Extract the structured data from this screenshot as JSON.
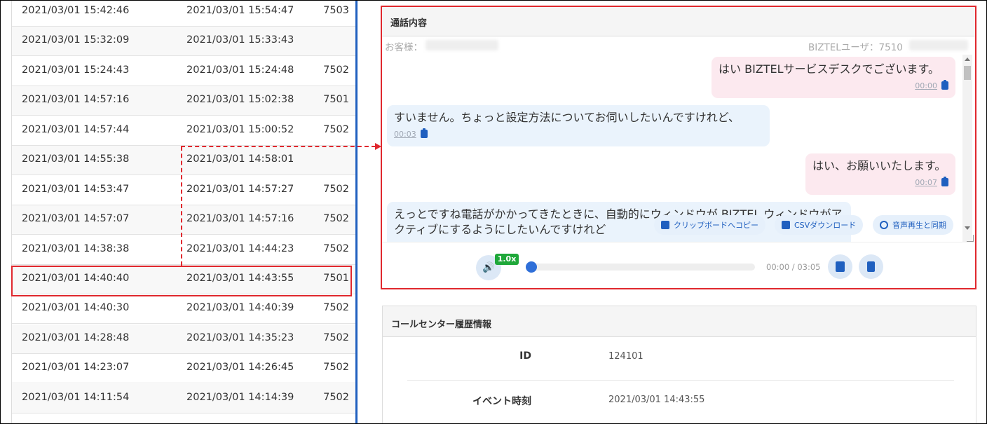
{
  "left_table": {
    "rows": [
      {
        "start": "2021/03/01 15:42:46",
        "end": "2021/03/01 15:54:47",
        "ext": "7503"
      },
      {
        "start": "2021/03/01 15:32:09",
        "end": "2021/03/01 15:33:43",
        "ext": ""
      },
      {
        "start": "2021/03/01 15:24:43",
        "end": "2021/03/01 15:24:48",
        "ext": "7502"
      },
      {
        "start": "2021/03/01 14:57:16",
        "end": "2021/03/01 15:02:38",
        "ext": "7501"
      },
      {
        "start": "2021/03/01 14:57:44",
        "end": "2021/03/01 15:00:52",
        "ext": "7502"
      },
      {
        "start": "2021/03/01 14:55:38",
        "end": "2021/03/01 14:58:01",
        "ext": ""
      },
      {
        "start": "2021/03/01 14:53:47",
        "end": "2021/03/01 14:57:27",
        "ext": "7502"
      },
      {
        "start": "2021/03/01 14:57:07",
        "end": "2021/03/01 14:57:16",
        "ext": "7502"
      },
      {
        "start": "2021/03/01 14:38:38",
        "end": "2021/03/01 14:44:23",
        "ext": "7502"
      },
      {
        "start": "2021/03/01 14:40:40",
        "end": "2021/03/01 14:43:55",
        "ext": "7501"
      },
      {
        "start": "2021/03/01 14:40:30",
        "end": "2021/03/01 14:40:39",
        "ext": "7502"
      },
      {
        "start": "2021/03/01 14:28:48",
        "end": "2021/03/01 14:35:23",
        "ext": "7502"
      },
      {
        "start": "2021/03/01 14:23:07",
        "end": "2021/03/01 14:26:45",
        "ext": "7502"
      },
      {
        "start": "2021/03/01 14:11:54",
        "end": "2021/03/01 14:14:39",
        "ext": "7502"
      }
    ]
  },
  "call": {
    "title": "通話内容",
    "customer_label": "お客様：",
    "user_label": "BIZTELユーザ：7510",
    "messages": [
      {
        "side": "right",
        "text": "はい BIZTELサービスデスクでございます。",
        "time": "00:00"
      },
      {
        "side": "left",
        "text": "すいません。ちょっと設定方法についてお伺いしたいんですけれど、",
        "time": "00:03"
      },
      {
        "side": "right",
        "text": "はい、お願いいたします。",
        "time": "00:07"
      },
      {
        "side": "left",
        "text": "えっとですね電話がかかってきたときに、自動的にウィンドウが BIZTEL ウィンドウがアクティブにするようにしたいんですけれど",
        "time": ""
      }
    ],
    "actions": {
      "copy": "クリップボードへコピー",
      "csv": "CSVダウンロード",
      "sync": "音声再生と同期"
    },
    "player": {
      "speed": "1.0x",
      "time": "00:00 / 03:05",
      "progress": 0
    }
  },
  "history": {
    "title": "コールセンター履歴情報",
    "fields": [
      {
        "label": "ID",
        "value": "124101"
      },
      {
        "label": "イベント時刻",
        "value": "2021/03/01 14:43:55"
      }
    ]
  },
  "colors": {
    "highlight": "#e0282e",
    "accent": "#1f5fbf",
    "speed_badge": "#1fa83a"
  }
}
